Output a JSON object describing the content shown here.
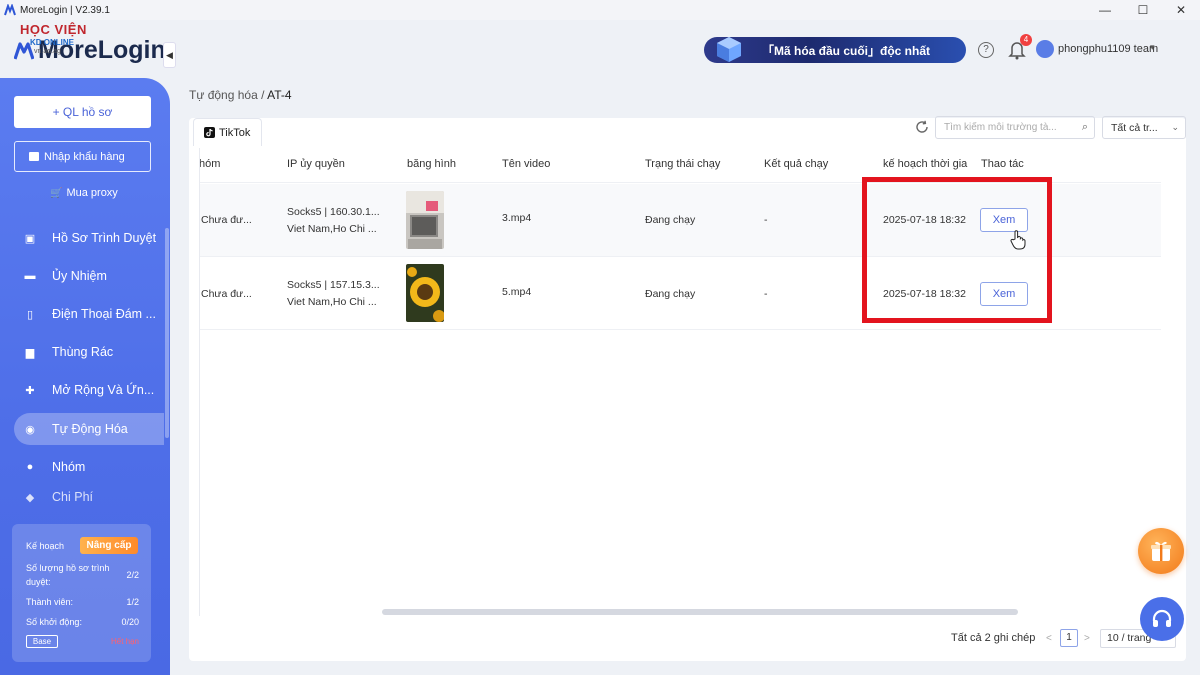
{
  "window": {
    "title": "MoreLogin | V2.39.1",
    "controls": {
      "minimize": "—",
      "maximize": "☐",
      "close": "✕"
    }
  },
  "header": {
    "watermark_line1": "HỌC VIỆN",
    "watermark_line2": "KD ONLINE",
    "watermark_site": "vn.ad.ag",
    "brand": "MoreLogin",
    "promo_text": "「Mã hóa đầu cuối」độc nhất",
    "help_label": "?",
    "notification_count": "4",
    "user_name": "phongphu1109 team",
    "user_caret": "▾"
  },
  "sidebar": {
    "add_profile": "+ QL hồ sơ",
    "collapse": "◀",
    "import": "Nhập khẩu hàng",
    "buy_proxy": "Mua proxy",
    "items": [
      {
        "label": "Hồ Sơ Trình Duyệt",
        "icon": "▣"
      },
      {
        "label": "Ủy Nhiệm",
        "icon": "▬"
      },
      {
        "label": "Điện Thoại Đám ...",
        "icon": "▯"
      },
      {
        "label": "Thùng Rác",
        "icon": "▆"
      },
      {
        "label": "Mở Rộng Và Ứn...",
        "icon": "✚"
      },
      {
        "label": "Tự Động Hóa",
        "icon": "◉"
      },
      {
        "label": "Nhóm",
        "icon": "●"
      },
      {
        "label": "Chi Phí",
        "icon": "◆"
      }
    ],
    "plan": {
      "label": "Kế hoạch",
      "upgrade": "Nâng cấp",
      "profiles_label_1": "Số lượng hồ sơ trình",
      "profiles_label_2": "duyệt:",
      "profiles_value": "2/2",
      "members_label": "Thành viên:",
      "members_value": "1/2",
      "launches_label": "Số khởi động:",
      "launches_value": "0/20",
      "tier": "Base",
      "expired": "Hết hạn"
    }
  },
  "breadcrumb": {
    "parent": "Tự động hóa",
    "sep": "/",
    "current": "AT-4"
  },
  "toolbar": {
    "tab": "TikTok",
    "search_placeholder": "Tìm kiếm môi trường tà...",
    "filter": "Tất cả tr..."
  },
  "table": {
    "columns": [
      "hóm",
      "IP ủy quyền",
      "băng hình",
      "Tên video",
      "Trạng thái chạy",
      "Kết quả chạy",
      "kế hoạch thời gia",
      "Thao tác"
    ],
    "rows": [
      {
        "group": "Chưa đư...",
        "proxy_1": "Socks5 | 160.30.1...",
        "proxy_2": "Viet Nam,Ho Chi ...",
        "video": "3.mp4",
        "status": "Đang chạy",
        "result": "-",
        "schedule": "2025-07-18 18:32",
        "action": "Xem"
      },
      {
        "group": "Chưa đư...",
        "proxy_1": "Socks5 | 157.15.3...",
        "proxy_2": "Viet Nam,Ho Chi ...",
        "video": "5.mp4",
        "status": "Đang chạy",
        "result": "-",
        "schedule": "2025-07-18 18:32",
        "action": "Xem"
      }
    ]
  },
  "pagination": {
    "total": "Tất cả 2 ghi chép",
    "prev": "<",
    "page": "1",
    "next": ">",
    "page_size": "10 / trang"
  },
  "colors": {
    "sidebar": "#5b7cf0",
    "accent": "#4a63d8",
    "highlight": "#e3141e"
  }
}
